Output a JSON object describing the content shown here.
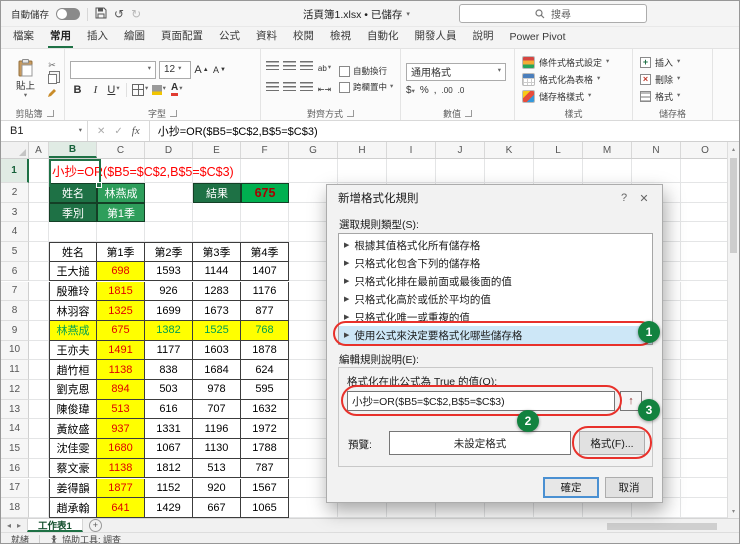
{
  "title_bar": {
    "autosave_label": "自動儲存",
    "doc_title": "活頁簿1.xlsx • 已儲存",
    "search_placeholder": "搜尋"
  },
  "tabs": {
    "items": [
      "檔案",
      "常用",
      "插入",
      "繪圖",
      "頁面配置",
      "公式",
      "資料",
      "校閱",
      "檢視",
      "自動化",
      "開發人員",
      "說明",
      "Power Pivot"
    ],
    "active": "常用"
  },
  "ribbon": {
    "clipboard": {
      "paste": "貼上",
      "group": "剪貼簿"
    },
    "font": {
      "size": "12",
      "group": "字型"
    },
    "alignment": {
      "wrap": "自動換行",
      "merge": "跨欄置中",
      "group": "對齊方式"
    },
    "number": {
      "format": "通用格式",
      "group": "數值"
    },
    "styles": {
      "items": [
        "條件式格式設定",
        "格式化為表格",
        "儲存格樣式"
      ],
      "group": "樣式"
    },
    "cells": {
      "items": [
        "插入",
        "刪除",
        "格式"
      ],
      "group": "儲存格"
    }
  },
  "formula_bar": {
    "name_box": "B1",
    "formula": "小抄=OR($B5=$C$2,B$5=$C$3)"
  },
  "grid": {
    "columns": [
      "A",
      "B",
      "C",
      "D",
      "E",
      "F",
      "G",
      "H",
      "I",
      "J",
      "K",
      "L",
      "M",
      "N",
      "O"
    ],
    "row_count": 18,
    "cheat_text": "小抄=OR($B5=$C$2,B$5=$C$3)",
    "info": {
      "name_label": "姓名",
      "name_value": "林燕成",
      "season_label": "季別",
      "season_value": "第1季",
      "result_label": "結果",
      "result_value": "675"
    },
    "table": {
      "headers": [
        "姓名",
        "第1季",
        "第2季",
        "第3季",
        "第4季"
      ],
      "rows": [
        [
          "王大搥",
          "698",
          "1593",
          "1144",
          "1407"
        ],
        [
          "殷雅玲",
          "1815",
          "926",
          "1283",
          "1176"
        ],
        [
          "林羽容",
          "1325",
          "1699",
          "1673",
          "877"
        ],
        [
          "林燕成",
          "675",
          "1382",
          "1525",
          "768"
        ],
        [
          "王亦夫",
          "1491",
          "1177",
          "1603",
          "1878"
        ],
        [
          "趙竹桓",
          "1138",
          "838",
          "1684",
          "624"
        ],
        [
          "劉克恩",
          "894",
          "503",
          "978",
          "595"
        ],
        [
          "陳俊瑋",
          "513",
          "616",
          "707",
          "1632"
        ],
        [
          "黃紋盛",
          "937",
          "1331",
          "1196",
          "1972"
        ],
        [
          "沈佳雯",
          "1680",
          "1067",
          "1130",
          "1788"
        ],
        [
          "蔡文豪",
          "1138",
          "1812",
          "513",
          "787"
        ],
        [
          "姜得韻",
          "1877",
          "1152",
          "920",
          "1567"
        ],
        [
          "趙承翰",
          "641",
          "1429",
          "667",
          "1065"
        ]
      ],
      "highlight_name": "林燕成"
    }
  },
  "dialog": {
    "title": "新增格式化規則",
    "select_rule_label": "選取規則類型(S):",
    "rule_bullet": "▶",
    "rules": [
      "根據其值格式化所有儲存格",
      "只格式化包含下列的儲存格",
      "只格式化排在最前面或最後面的值",
      "只格式化高於或低於平均的值",
      "只格式化唯一或重複的值",
      "使用公式來決定要格式化哪些儲存格"
    ],
    "selected_rule_index": 5,
    "edit_rule_label": "編輯規則說明(E):",
    "formula_label": "格式化在此公式為 True 的值(O):",
    "formula_value": "小抄=OR($B5=$C$2,B$5=$C$3)",
    "preview_label": "預覽:",
    "preview_value": "未設定格式",
    "format_button": "格式(F)...",
    "ok_button": "確定",
    "cancel_button": "取消",
    "step_badges": [
      "1",
      "2",
      "3"
    ]
  },
  "sheet_tabs": {
    "active": "工作表1",
    "add": "+"
  },
  "status": {
    "mode": "就緒",
    "accessibility": "協助工具: 調查"
  },
  "icons": {
    "caret": "▾",
    "help": "?",
    "close": "✕",
    "check": "✓",
    "cancel_x": "✕",
    "fx": "fx",
    "undo": "↺",
    "redo": "↻",
    "cut": "✂",
    "bold": "B",
    "italic": "I",
    "underline": "U",
    "dollar": "$",
    "percent": "%",
    "comma": ",",
    "increase_decimal": ".00",
    "decrease_decimal": ".0",
    "tab_prev": "◂",
    "tab_next": "▸",
    "up_arrow": "↑",
    "scroll_up": "▴",
    "scroll_down": "▾"
  }
}
